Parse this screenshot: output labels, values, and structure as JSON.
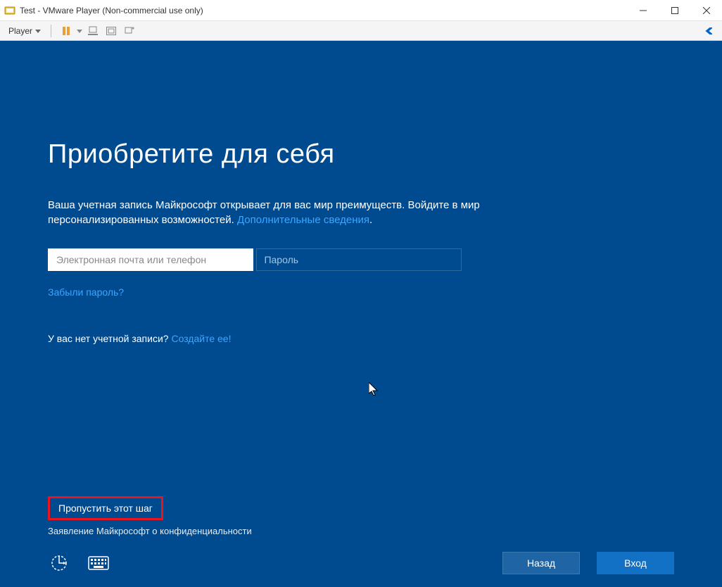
{
  "window": {
    "title": "Test - VMware Player (Non-commercial use only)"
  },
  "toolbar": {
    "player_label": "Player"
  },
  "setup": {
    "heading": "Приобретите для себя",
    "subtext_1": "Ваша учетная запись Майкрософт открывает для вас мир преимуществ. Войдите в мир персонализированных возможностей. ",
    "learn_more": "Дополнительные сведения",
    "email_placeholder": "Электронная почта или телефон",
    "password_placeholder": "Пароль",
    "forgot": "Забыли пароль?",
    "no_account": "У вас нет учетной записи? ",
    "create_one": "Создайте ее!",
    "skip": "Пропустить этот шаг",
    "privacy": "Заявление Майкрософт о конфиденциальности",
    "back": "Назад",
    "signin": "Вход"
  }
}
